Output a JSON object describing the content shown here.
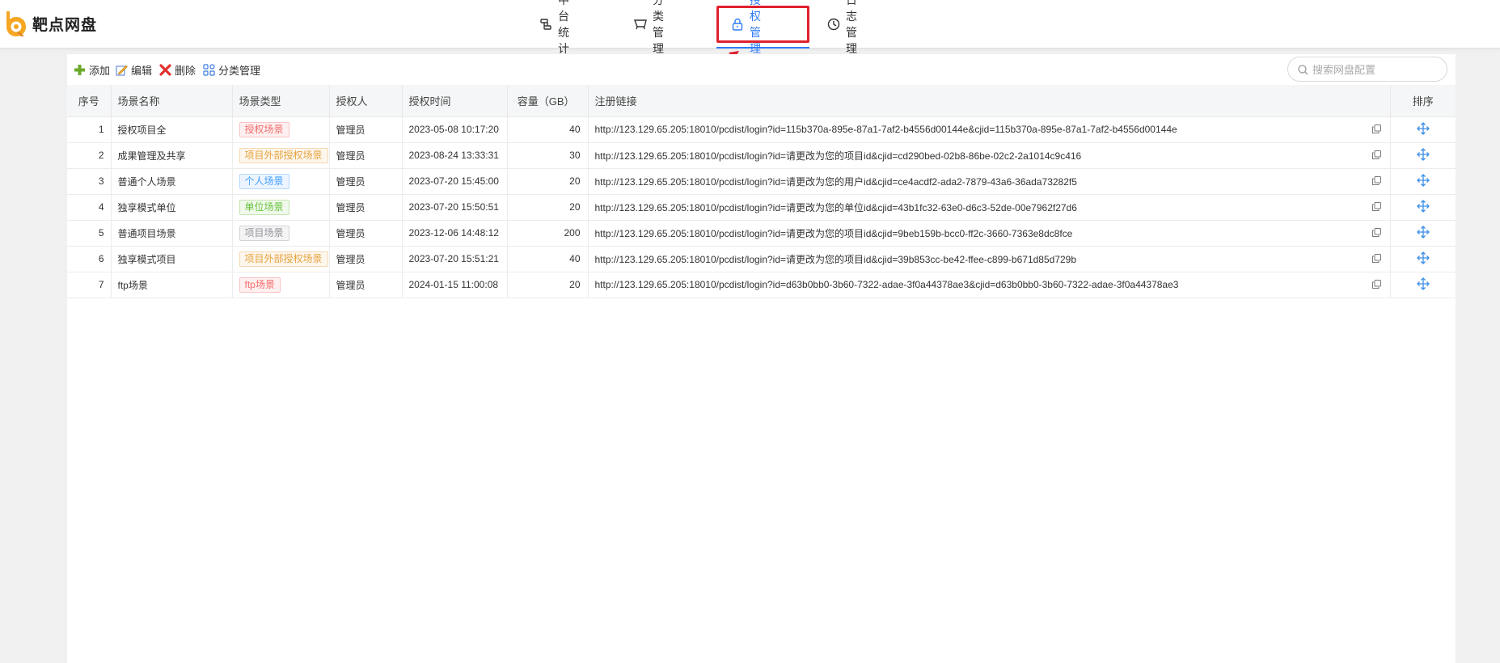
{
  "app": {
    "title": "靶点网盘",
    "colors": {
      "accent": "#2f7df6",
      "logo": "#f5a623",
      "highlight": "#e0212e"
    }
  },
  "nav": {
    "items": [
      {
        "label": "中台统计",
        "icon": "connection-icon"
      },
      {
        "label": "分类管理",
        "icon": "category-icon"
      },
      {
        "label": "授权管理",
        "icon": "lock-icon",
        "active": true
      },
      {
        "label": "日志管理",
        "icon": "clock-icon"
      }
    ]
  },
  "toolbar": {
    "add": "添加",
    "edit": "编辑",
    "delete": "删除",
    "category": "分类管理"
  },
  "search": {
    "placeholder": "搜索网盘配置",
    "value": ""
  },
  "table": {
    "columns": [
      "序号",
      "场景名称",
      "场景类型",
      "授权人",
      "授权时间",
      "容量（GB）",
      "注册链接",
      "排序"
    ],
    "rows": [
      {
        "no": "1",
        "name": "授权项目全",
        "type": "授权场景",
        "type_color": "red",
        "owner": "管理员",
        "time": "2023-05-08 10:17:20",
        "capacity": "40",
        "link": "http://123.129.65.205:18010/pcdist/login?id=115b370a-895e-87a1-7af2-b4556d00144e&cjid=115b370a-895e-87a1-7af2-b4556d00144e"
      },
      {
        "no": "2",
        "name": "成果管理及共享",
        "type": "项目外部授权场景",
        "type_color": "orange",
        "owner": "管理员",
        "time": "2023-08-24 13:33:31",
        "capacity": "30",
        "link": "http://123.129.65.205:18010/pcdist/login?id=请更改为您的项目id&cjid=cd290bed-02b8-86be-02c2-2a1014c9c416"
      },
      {
        "no": "3",
        "name": "普通个人场景",
        "type": "个人场景",
        "type_color": "blue",
        "owner": "管理员",
        "time": "2023-07-20 15:45:00",
        "capacity": "20",
        "link": "http://123.129.65.205:18010/pcdist/login?id=请更改为您的用户id&cjid=ce4acdf2-ada2-7879-43a6-36ada73282f5"
      },
      {
        "no": "4",
        "name": "独享模式单位",
        "type": "单位场景",
        "type_color": "green",
        "owner": "管理员",
        "time": "2023-07-20 15:50:51",
        "capacity": "20",
        "link": "http://123.129.65.205:18010/pcdist/login?id=请更改为您的单位id&cjid=43b1fc32-63e0-d6c3-52de-00e7962f27d6"
      },
      {
        "no": "5",
        "name": "普通项目场景",
        "type": "项目场景",
        "type_color": "gray",
        "owner": "管理员",
        "time": "2023-12-06 14:48:12",
        "capacity": "200",
        "link": "http://123.129.65.205:18010/pcdist/login?id=请更改为您的项目id&cjid=9beb159b-bcc0-ff2c-3660-7363e8dc8fce"
      },
      {
        "no": "6",
        "name": "独享模式项目",
        "type": "项目外部授权场景",
        "type_color": "orange",
        "owner": "管理员",
        "time": "2023-07-20 15:51:21",
        "capacity": "40",
        "link": "http://123.129.65.205:18010/pcdist/login?id=请更改为您的项目id&cjid=39b853cc-be42-ffee-c899-b671d85d729b"
      },
      {
        "no": "7",
        "name": "ftp场景",
        "type": "ftp场景",
        "type_color": "red",
        "owner": "管理员",
        "time": "2024-01-15 11:00:08",
        "capacity": "20",
        "link": "http://123.129.65.205:18010/pcdist/login?id=d63b0bb0-3b60-7322-adae-3f0a44378ae3&cjid=d63b0bb0-3b60-7322-adae-3f0a44378ae3"
      }
    ]
  }
}
